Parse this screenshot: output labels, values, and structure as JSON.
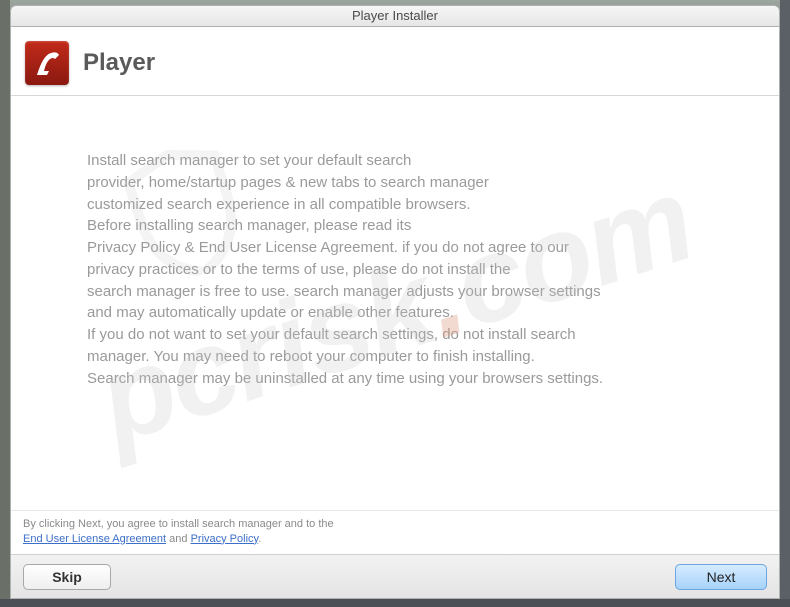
{
  "window": {
    "title": "Player Installer"
  },
  "header": {
    "title": "Player",
    "icon_name": "flash-icon"
  },
  "body": {
    "lines": [
      "Install search manager to set your default search",
      "provider, home/startup pages & new tabs to search manager",
      "customized search experience in all compatible browsers.",
      "Before installing search manager, please read its",
      "Privacy Policy & End User License Agreement. if you do not agree to our",
      "privacy practices or to the terms of use, please do not install the",
      "search manager is free to use. search manager adjusts your browser settings",
      "and may automatically update or enable other features.",
      "If you do not want to set your default search settings, do not install search",
      "manager. You may need to reboot your computer to finish installing.",
      "Search manager may be uninstalled at any time using your browsers settings."
    ]
  },
  "footer": {
    "agree_prefix": "By clicking Next, you agree to install search manager and to the",
    "eula_label": "End User License Agreement",
    "and_label": " and ",
    "privacy_label": "Privacy Policy",
    "period": "."
  },
  "buttons": {
    "skip": "Skip",
    "next": "Next"
  },
  "watermark": {
    "text_prefix": "pcrisk",
    "dot": ".",
    "text_suffix": "com"
  }
}
